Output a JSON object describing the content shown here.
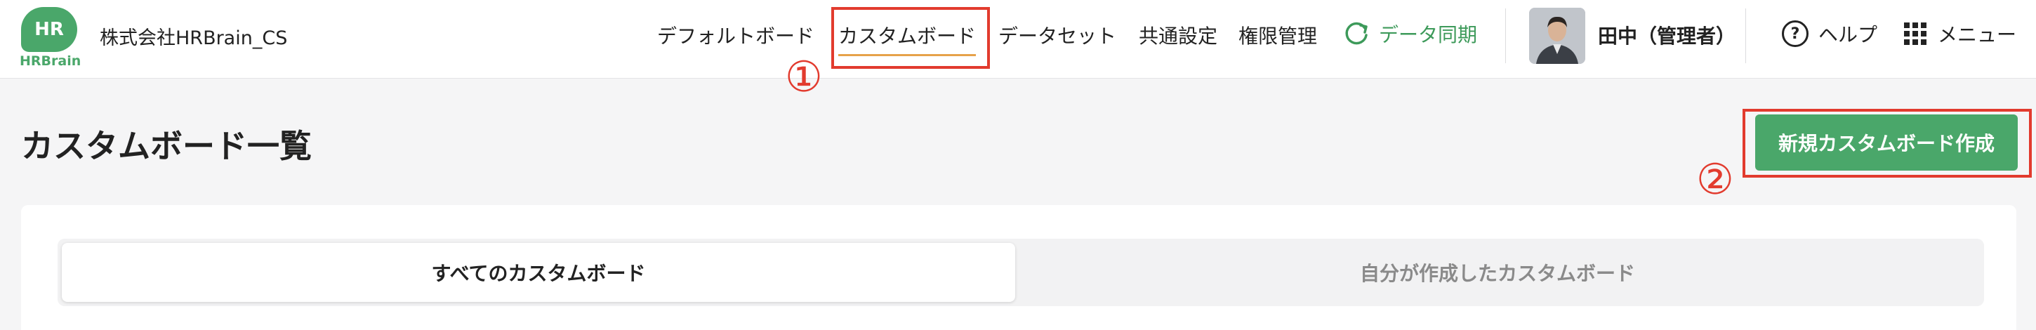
{
  "header": {
    "logo": {
      "main": "HR",
      "sub": "HRBrain"
    },
    "company": "株式会社HRBrain_CS",
    "nav": {
      "default_board": "デフォルトボード",
      "custom_board": "カスタムボード",
      "dataset": "データセット",
      "common_settings": "共通設定",
      "permissions": "権限管理"
    },
    "sync_label": "データ同期",
    "user_name": "田中（管理者）",
    "help_label": "ヘルプ",
    "menu_label": "メニュー"
  },
  "annotations": {
    "one": "①",
    "two": "②"
  },
  "main": {
    "title": "カスタムボード一覧",
    "create_button": "新規カスタムボード作成",
    "tabs": [
      {
        "label": "すべてのカスタムボード",
        "active": true
      },
      {
        "label": "自分が作成したカスタムボード",
        "active": false
      }
    ]
  },
  "colors": {
    "brand_green": "#4aa76a",
    "sync_green": "#3d9a5a",
    "annotation_red": "#e23b2e",
    "active_underline": "#e6a24a"
  },
  "icons": [
    "refresh-icon",
    "help-icon",
    "grid-menu-icon",
    "avatar"
  ]
}
